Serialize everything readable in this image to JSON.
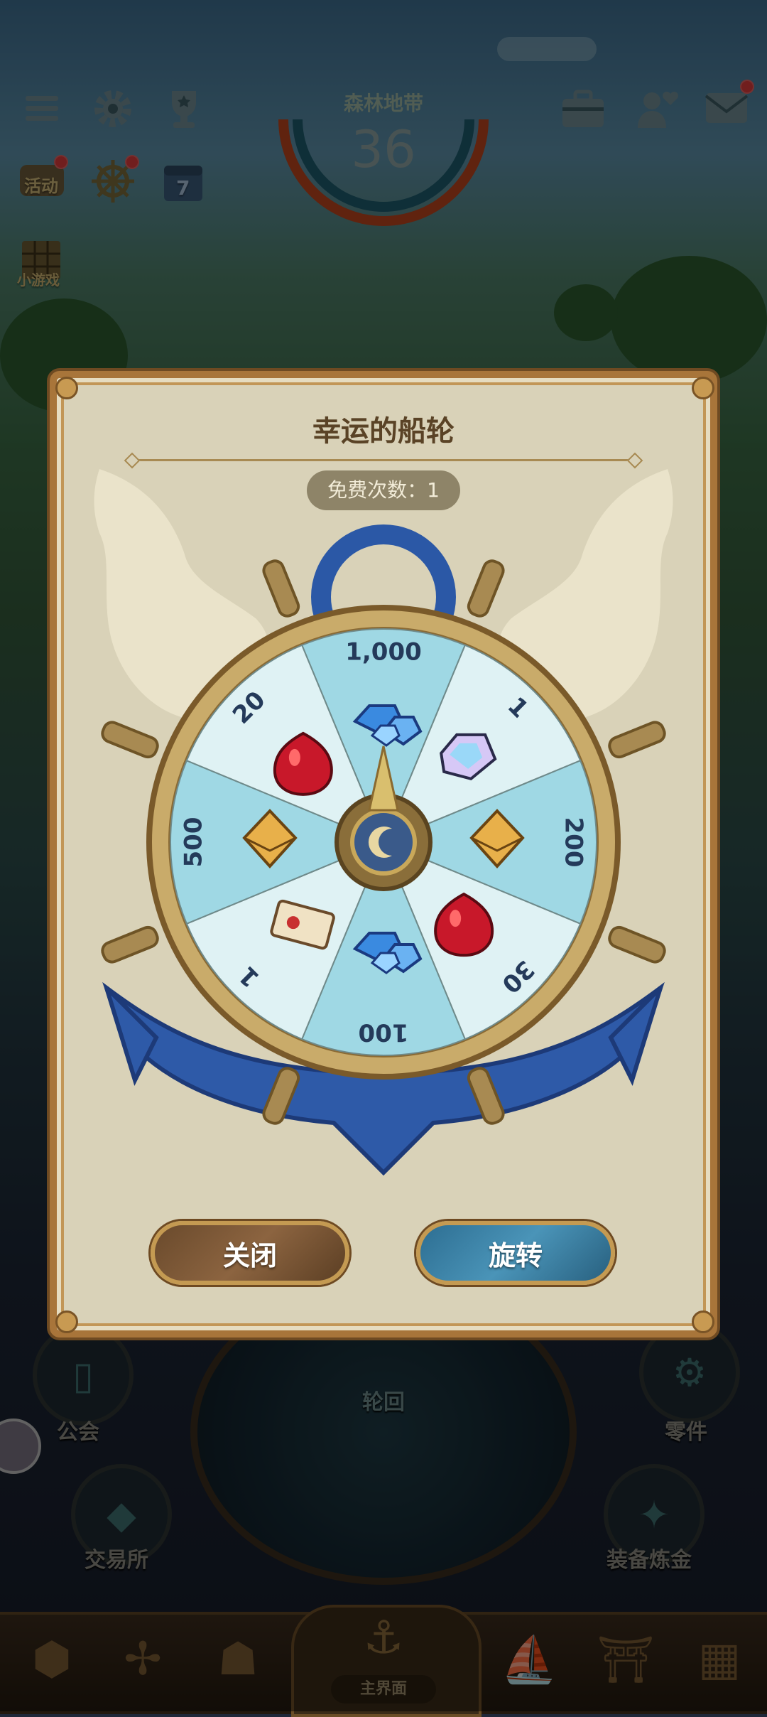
{
  "hud": {
    "zone_name": "森林地带",
    "zone_level": "36",
    "activity_label": "活动",
    "calendar_day": "7",
    "minigame_label": "小游戏"
  },
  "dialog": {
    "title": "幸运的船轮",
    "free_spins": "免费次数：1",
    "close_label": "关闭",
    "spin_label": "旋转"
  },
  "wheel": {
    "segments": [
      {
        "amount": "1,000",
        "reward": "blue-crystals-icon"
      },
      {
        "amount": "1",
        "reward": "rainbow-gem-icon"
      },
      {
        "amount": "200",
        "reward": "gold-envelope-icon"
      },
      {
        "amount": "30",
        "reward": "ruby-icon"
      },
      {
        "amount": "100",
        "reward": "blue-crystals-icon"
      },
      {
        "amount": "1",
        "reward": "ticket-icon"
      },
      {
        "amount": "500",
        "reward": "gold-envelope-icon"
      },
      {
        "amount": "20",
        "reward": "ruby-icon"
      }
    ]
  },
  "side_menu": {
    "guild": "公会",
    "parts": "零件",
    "exchange": "交易所",
    "equip_refine": "装备炼金",
    "reincarnation": "轮回"
  },
  "bottom_nav": {
    "main_label": "主界面"
  },
  "colors": {
    "dialog_bg": "#d9d2b8",
    "frame": "#a8753a",
    "wheel_light": "#dff2f4",
    "wheel_dark": "#9fd8e4",
    "close_button": "#7a5636",
    "spin_button": "#3a84a8"
  }
}
